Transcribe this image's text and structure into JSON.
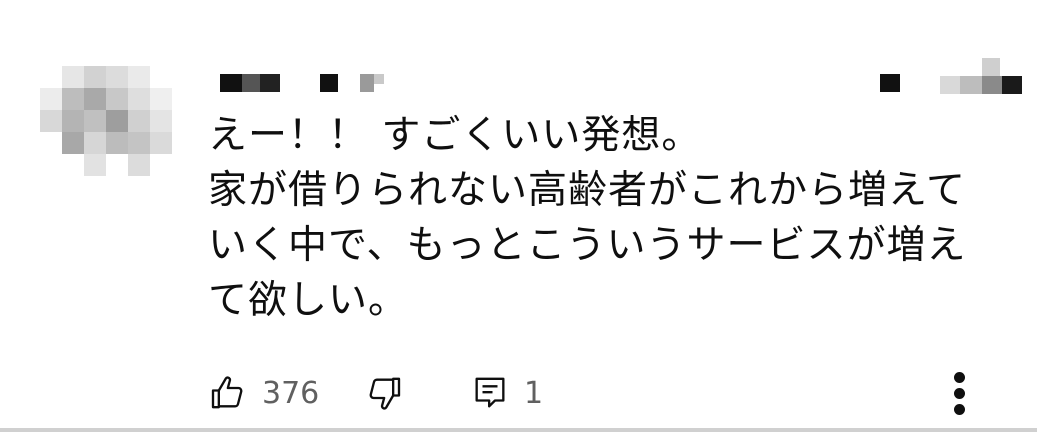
{
  "comment": {
    "lines": [
      "えー！！ すごくいい発想。",
      "家が借りられない高齢者がこれから増えて",
      "いく中で、もっとこういうサービスが増え",
      "て欲しい。"
    ]
  },
  "actions": {
    "like_count": "376",
    "reply_count": "1"
  },
  "icons": {
    "like": "thumbs-up-icon",
    "dislike": "thumbs-down-icon",
    "reply": "comment-icon",
    "more": "more-vertical-icon"
  },
  "colors": {
    "text": "#0f0f0f",
    "meta": "#606060",
    "background": "#ffffff"
  }
}
